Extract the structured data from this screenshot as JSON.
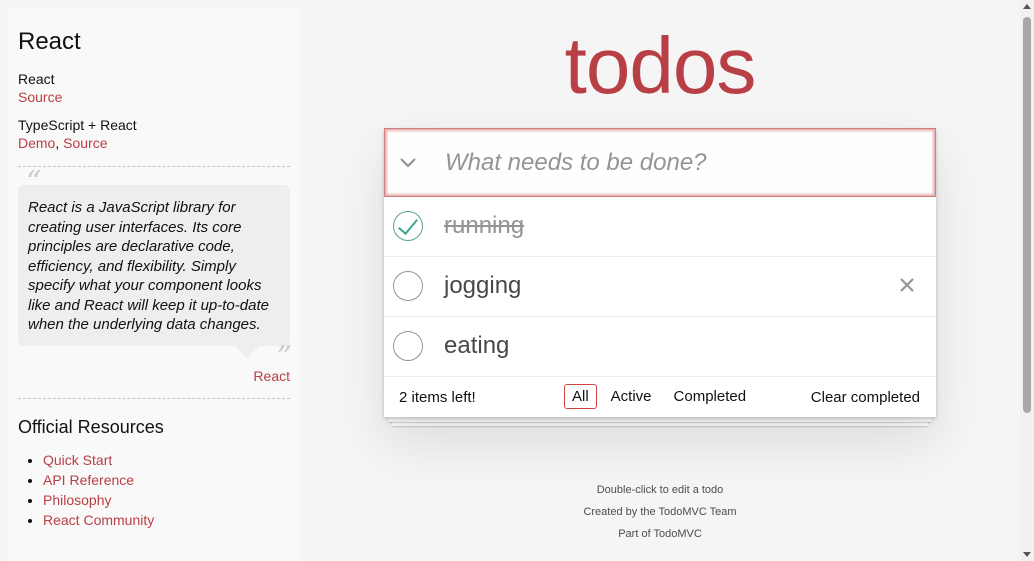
{
  "sidebar": {
    "framework_title": "React",
    "implementations": [
      {
        "name": "React",
        "links": [
          "Source"
        ]
      },
      {
        "name": "TypeScript + React",
        "links": [
          "Demo",
          "Source"
        ]
      }
    ],
    "quote": {
      "text": "React is a JavaScript library for creating user interfaces. Its core principles are declarative code, efficiency, and flexibility. Simply specify what your component looks like and React will keep it up-to-date when the underlying data changes.",
      "source": "React"
    },
    "resources_title": "Official Resources",
    "resources": [
      "Quick Start",
      "API Reference",
      "Philosophy",
      "React Community"
    ]
  },
  "app": {
    "title": "todos",
    "new_todo_placeholder": "What needs to be done?",
    "todos": [
      {
        "label": "running",
        "completed": true
      },
      {
        "label": "jogging",
        "completed": false
      },
      {
        "label": "eating",
        "completed": false
      }
    ],
    "footer": {
      "count": "2 items left!",
      "filters": [
        "All",
        "Active",
        "Completed"
      ],
      "selected_filter": "All",
      "clear_label": "Clear completed"
    }
  },
  "info": {
    "line1": "Double-click to edit a todo",
    "line2": "Created by the TodoMVC Team",
    "line3": "Part of TodoMVC"
  },
  "colors": {
    "accent": "#b83f45",
    "check": "#3ea390"
  },
  "icons": {
    "toggle_all": "chevron-down-icon",
    "destroy": "close-icon",
    "check": "checkmark-icon"
  }
}
